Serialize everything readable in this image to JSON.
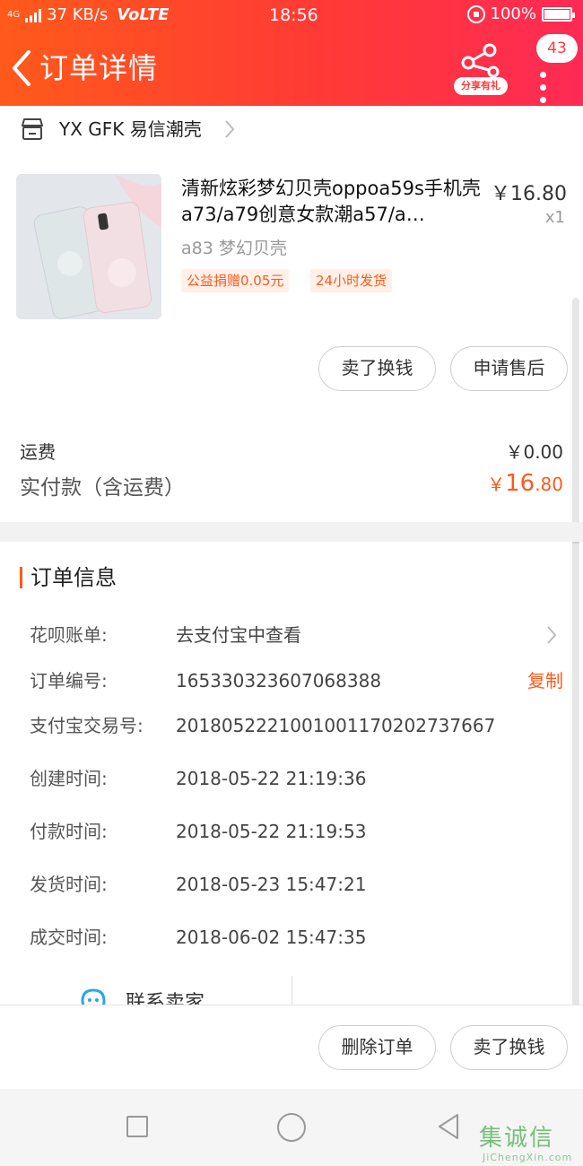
{
  "status_bar": {
    "network": "4G",
    "speed": "37 KB/s",
    "volte": "VoLTE",
    "time": "18:56",
    "battery": "100%"
  },
  "header": {
    "title": "订单详情",
    "share_label": "分享有礼",
    "message_count": "43",
    "colors": {
      "gradient_start": "#ff5a1b",
      "gradient_end": "#ff2a55"
    }
  },
  "shop": {
    "name": "YX GFK 易信潮壳"
  },
  "product": {
    "title": "清新炫彩梦幻贝壳oppoa59s手机壳a73/a79创意女款潮a57/a…",
    "price": "￥16.80",
    "quantity": "x1",
    "sku": "a83    梦幻贝壳",
    "tags": [
      "公益捐赠0.05元",
      "24小时发货"
    ]
  },
  "product_actions": {
    "sell_label": "卖了换钱",
    "aftersale_label": "申请售后"
  },
  "summary": {
    "shipping_label": "运费",
    "shipping_value": "￥0.00",
    "paid_label": "实付款（含运费）",
    "paid_currency": "￥",
    "paid_integer": "16",
    "paid_decimal": ".80"
  },
  "order_info": {
    "section_title": "订单信息",
    "rows": [
      {
        "label": "花呗账单:",
        "value": "去支付宝中查看"
      },
      {
        "label": "订单编号:",
        "value": "165330323607068388",
        "action": "复制"
      },
      {
        "label": "支付宝交易号:",
        "value": "2018052221001001170202737667"
      },
      {
        "label": "创建时间:",
        "value": "2018-05-22 21:19:36"
      },
      {
        "label": "付款时间:",
        "value": "2018-05-22 21:19:53"
      },
      {
        "label": "发货时间:",
        "value": "2018-05-23 15:47:21"
      },
      {
        "label": "成交时间:",
        "value": "2018-06-02 15:47:35"
      }
    ]
  },
  "contact": {
    "label": "联系卖家"
  },
  "bottom_actions": {
    "delete_label": "删除订单",
    "sell_label": "卖了换钱"
  },
  "watermark": {
    "main": "集诚信",
    "sub": "JiChengXin.com"
  },
  "icons": [
    "back-icon",
    "share-icon",
    "more-icon",
    "shop-icon",
    "chevron-right-icon",
    "chat-icon",
    "square-nav-icon",
    "circle-nav-icon",
    "triangle-back-nav-icon"
  ]
}
